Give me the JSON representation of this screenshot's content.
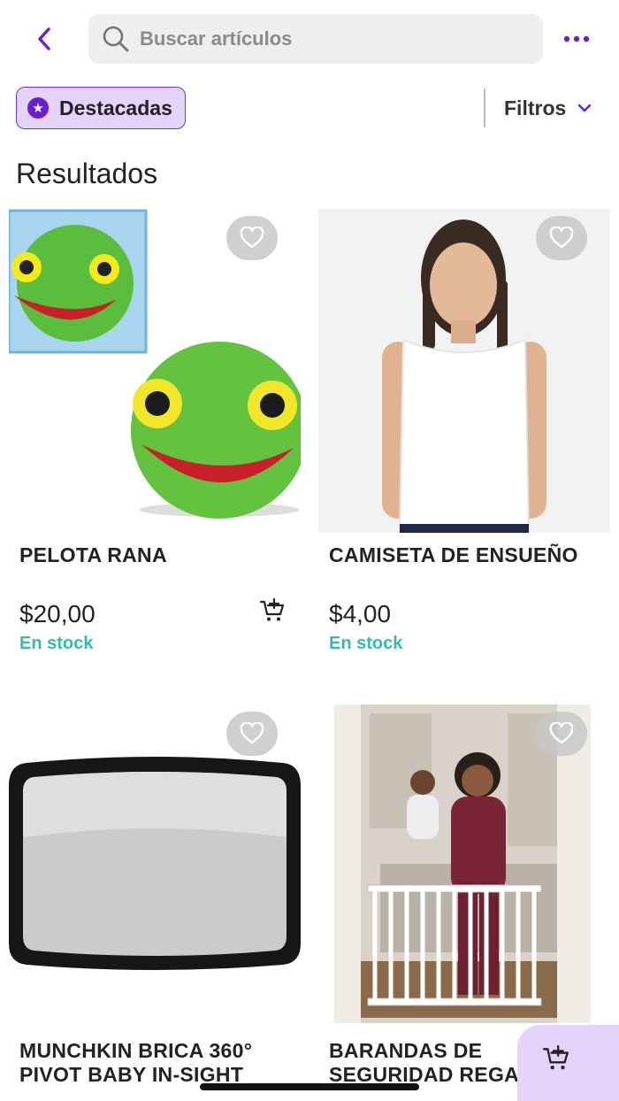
{
  "search": {
    "placeholder": "Buscar artículos"
  },
  "filters": {
    "chip_label": "Destacadas",
    "filters_label": "Filtros"
  },
  "section_title": "Resultados",
  "products": [
    {
      "name": "PELOTA RANA",
      "price": "$20,00",
      "stock": "En stock"
    },
    {
      "name": "CAMISETA DE ENSUEÑO",
      "price": "$4,00",
      "stock": "En stock"
    },
    {
      "name_line1": "MUNCHKIN BRICA 360°",
      "name_line2": "PIVOT BABY IN-SIGHT"
    },
    {
      "name_line1": "BARANDAS DE",
      "name_line2": "SEGURIDAD REGA"
    }
  ],
  "colors": {
    "accent": "#6a1fd1",
    "chip_bg": "#e4d3fb",
    "stock": "#3ab7b0"
  },
  "icons": [
    "back-chevron-icon",
    "search-icon",
    "more-dots-icon",
    "star-icon",
    "chevron-down-icon",
    "heart-icon",
    "add-cart-icon",
    "cart-icon"
  ]
}
